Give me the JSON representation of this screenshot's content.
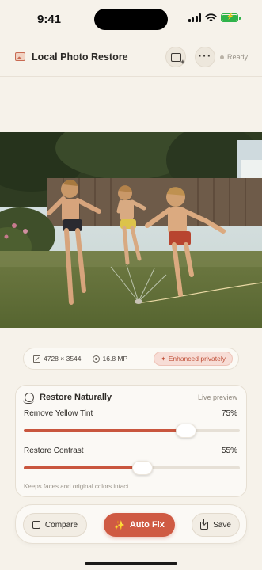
{
  "status_bar": {
    "time": "9:41"
  },
  "header": {
    "title": "Local Photo Restore",
    "status": "Ready",
    "icons": {
      "logo": "photo-icon",
      "gallery": "add-photo-icon",
      "more": "more-icon"
    }
  },
  "photo": {
    "description_icon": "photo"
  },
  "meta": {
    "dimensions": "4728 × 3544",
    "megapixels": "16.8 MP",
    "privacy_badge": "Enhanced privately"
  },
  "restore": {
    "title": "Restore Naturally",
    "preview_label": "Live preview",
    "sliders": [
      {
        "label": "Remove Yellow Tint",
        "value_text": "75%",
        "value": 75
      },
      {
        "label": "Restore Contrast",
        "value_text": "55%",
        "value": 55
      }
    ],
    "hint": "Keeps faces and original colors intact."
  },
  "actions": {
    "compare": "Compare",
    "auto_fix": "Auto Fix",
    "save": "Save"
  },
  "colors": {
    "accent": "#cf5a43",
    "background": "#f6f2ea",
    "ready_dot": "#b9b2a6"
  }
}
